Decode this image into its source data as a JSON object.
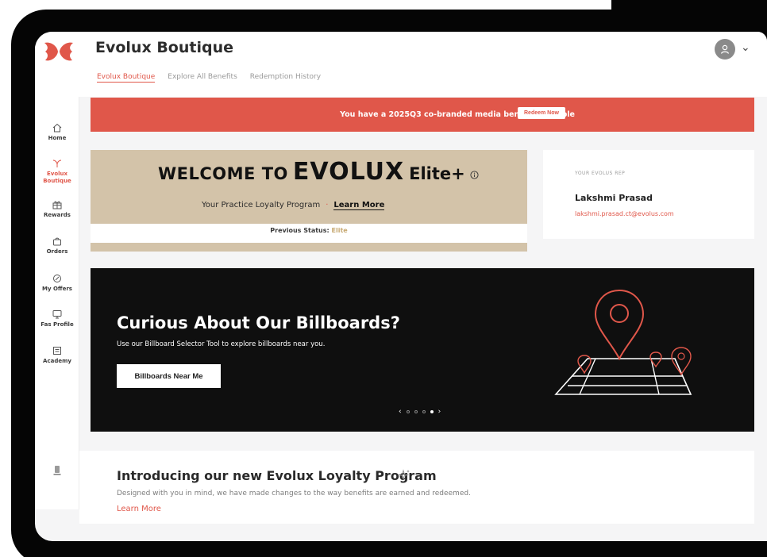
{
  "header": {
    "title": "Evolux Boutique",
    "tabs": [
      {
        "label": "Evolux Boutique",
        "active": true
      },
      {
        "label": "Explore All Benefits",
        "active": false
      },
      {
        "label": "Redemption History",
        "active": false
      }
    ]
  },
  "sidebar": {
    "items": [
      {
        "label": "Home",
        "icon": "home-icon"
      },
      {
        "label": "Evolux Boutique",
        "icon": "boutique-icon",
        "active": true
      },
      {
        "label": "Rewards",
        "icon": "gift-icon"
      },
      {
        "label": "Orders",
        "icon": "bag-icon"
      },
      {
        "label": "My Offers",
        "icon": "offer-icon"
      },
      {
        "label": "Fas Profile",
        "icon": "profile-icon"
      },
      {
        "label": "Academy",
        "icon": "academy-icon"
      }
    ]
  },
  "alert": {
    "text": "You have a 2025Q3 co-branded media benefit available",
    "button": "Redeem Now"
  },
  "welcome": {
    "lead": "WELCOME TO",
    "brand": "EVOLUX",
    "tier": "Elite+",
    "program": "Your Practice Loyalty Program",
    "learn_more": "Learn More",
    "previous_status_label": "Previous Status:",
    "previous_status_value": "Elite"
  },
  "rep": {
    "caption": "YOUR EVOLUS REP",
    "name": "Lakshmi Prasad",
    "email": "lakshmi.prasad.ct@evolus.com"
  },
  "hero": {
    "title": "Curious About Our Billboards?",
    "subtitle": "Use our Billboard Selector Tool to explore billboards near you.",
    "button": "Billboards Near Me",
    "carousel_slides": 4,
    "carousel_active": 4
  },
  "intro": {
    "title": "Introducing our new Evolux Loyalty Program",
    "body": "Designed with you in mind, we have made changes to the way benefits are earned and redeemed.",
    "link": "Learn More"
  },
  "colors": {
    "accent": "#e0574a",
    "tan": "#d3c3a9",
    "hero_bg": "#0f0f0f"
  }
}
